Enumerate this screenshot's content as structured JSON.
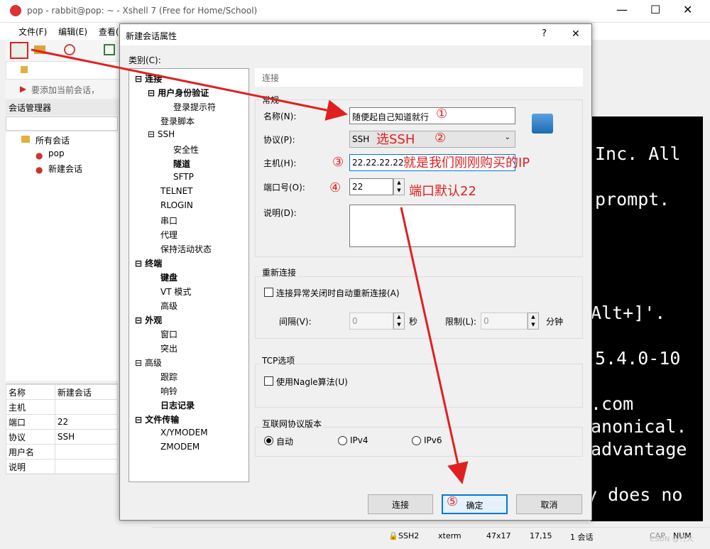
{
  "window": {
    "title": "pop - rabbit@pop: ~ - Xshell 7 (Free for Home/School)"
  },
  "menu": [
    "文件(F)",
    "编辑(E)",
    "查看(V"
  ],
  "linkbar": {
    "text": "要添加当前会话，"
  },
  "session_manager": {
    "title": "会话管理器",
    "tree": [
      "所有会话",
      "pop",
      "新建会话"
    ]
  },
  "properties": [
    [
      "名称",
      "新建会话"
    ],
    [
      "主机",
      ""
    ],
    [
      "端口",
      "22"
    ],
    [
      "协议",
      "SSH"
    ],
    [
      "用户名",
      ""
    ],
    [
      "说明",
      ""
    ]
  ],
  "terminal": {
    "lines": [
      "Inc. All",
      "prompt.",
      "Alt+]'.",
      "5.4.0-10",
      ".com",
      "anonical.",
      "advantage",
      "y does no"
    ]
  },
  "status": {
    "ssh": "SSH2",
    "term": "xterm",
    "size": "47x17",
    "pos": "17,15",
    "sessions": "1 会话",
    "cap": "CAP",
    "num": "NUM"
  },
  "watermark": "CSDN @竹大",
  "dialog": {
    "title": "新建会话属性",
    "help": "?",
    "close": "✕",
    "category_label": "类别(C):",
    "tree": [
      {
        "t": "⊟ 连接",
        "b": true
      },
      {
        "t": "⊟ 用户身份验证",
        "b": true
      },
      {
        "t": "登录提示符"
      },
      {
        "t": "登录脚本"
      },
      {
        "t": "⊟ SSH"
      },
      {
        "t": "安全性"
      },
      {
        "t": "隧道",
        "b": true
      },
      {
        "t": "SFTP"
      },
      {
        "t": "TELNET"
      },
      {
        "t": "RLOGIN"
      },
      {
        "t": "串口"
      },
      {
        "t": "代理"
      },
      {
        "t": "保持活动状态"
      },
      {
        "t": "⊟ 终端",
        "b": true
      },
      {
        "t": "键盘",
        "b": true
      },
      {
        "t": "VT 模式"
      },
      {
        "t": "高级"
      },
      {
        "t": "⊟ 外观",
        "b": true
      },
      {
        "t": "窗口"
      },
      {
        "t": "突出"
      },
      {
        "t": "⊟ 高级"
      },
      {
        "t": "跟踪"
      },
      {
        "t": "响铃"
      },
      {
        "t": "日志记录",
        "b": true
      },
      {
        "t": "⊟ 文件传输",
        "b": true
      },
      {
        "t": "X/YMODEM"
      },
      {
        "t": "ZMODEM"
      }
    ],
    "breadcrumb": "连接",
    "general": {
      "legend": "常规",
      "name_label": "名称(N):",
      "name_value": "随便起自己知道就行",
      "protocol_label": "协议(P):",
      "protocol_value": "SSH",
      "host_label": "主机(H):",
      "host_value": "22.22.22.22",
      "port_label": "端口号(O):",
      "port_value": "22",
      "desc_label": "说明(D):",
      "desc_value": ""
    },
    "reconnect": {
      "legend": "重新连接",
      "checkbox": "连接异常关闭时自动重新连接(A)",
      "interval_label": "间隔(V):",
      "interval_value": "0",
      "sec": "秒",
      "limit_label": "限制(L):",
      "limit_value": "0",
      "min": "分钟"
    },
    "tcp": {
      "legend": "TCP选项",
      "checkbox": "使用Nagle算法(U)"
    },
    "ipver": {
      "legend": "互联网协议版本",
      "auto": "自动",
      "ipv4": "IPv4",
      "ipv6": "IPv6"
    },
    "buttons": {
      "connect": "连接",
      "ok": "确定",
      "cancel": "取消"
    }
  },
  "annotations": {
    "c1": "①",
    "c2": "②",
    "c3": "③",
    "c4": "④",
    "c5": "⑤",
    "ssh": "选SSH",
    "ip": "就是我们刚刚购买的IP",
    "port": "端口默认22"
  },
  "colors": {
    "annotation": "#e02020",
    "accent": "#0078d7",
    "terminal_bg": "#000000"
  }
}
